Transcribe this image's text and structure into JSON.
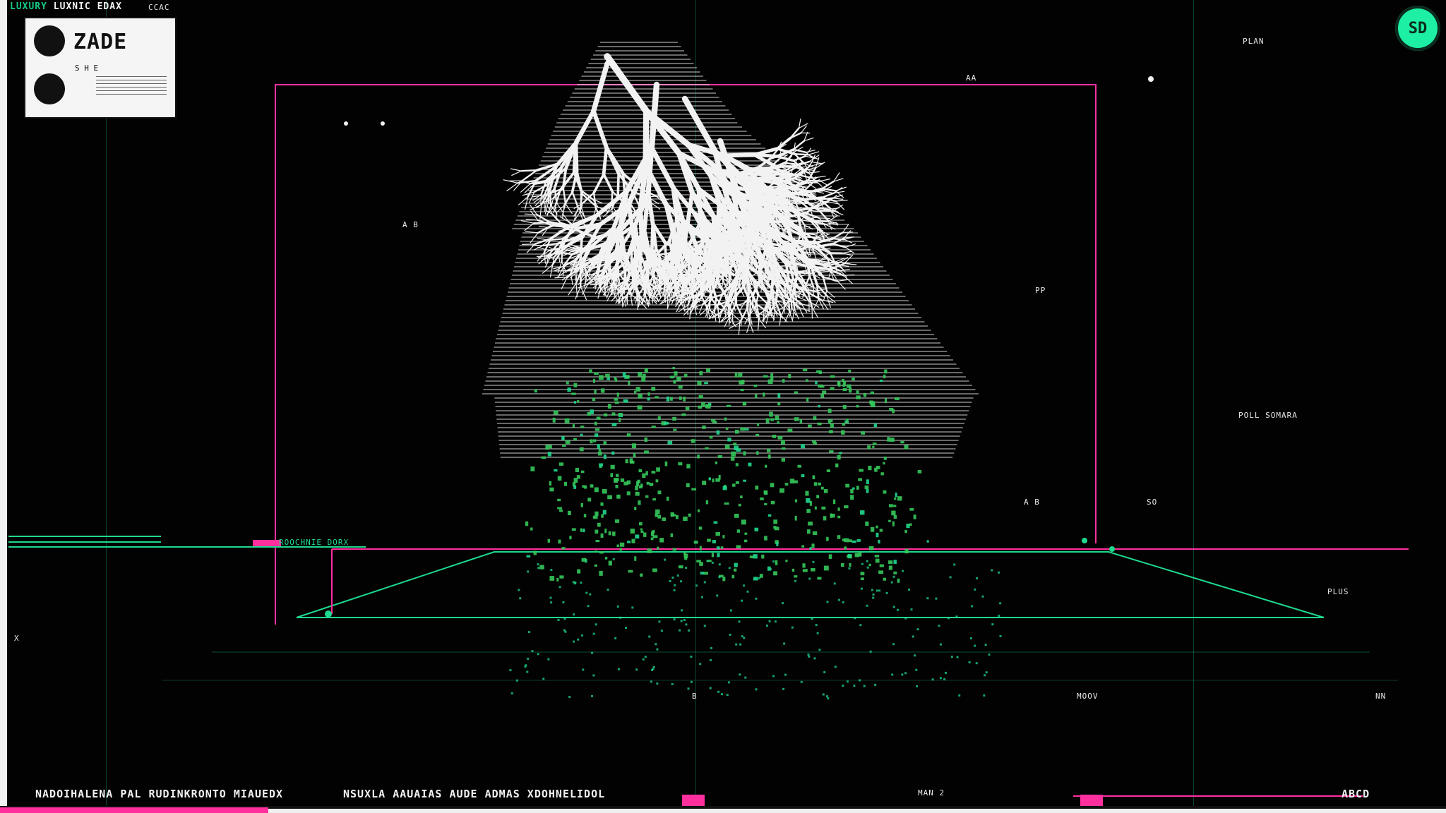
{
  "app": {
    "title_prefix": "LUXURY",
    "title_main": "LUXNIC EDAX",
    "title_right": "CCAC"
  },
  "panel": {
    "title": "ZADE",
    "subtitle": "S H E",
    "icon_top": "avatar-icon",
    "icon_bottom": "map-icon"
  },
  "badge": {
    "label": "SD"
  },
  "labels": {
    "left_grid": "ROOCHNIE DORX",
    "right_grid": "POLL SOMARA",
    "upper_left": "A B",
    "upper_mid": "AA",
    "upper_right": "PLAN",
    "marker_a": "A B",
    "marker_b": "PP",
    "marker_c": "SO",
    "marker_d": "MOOV",
    "marker_e": "B",
    "marker_f": "PLUS",
    "marker_g": "X",
    "marker_h": "NN"
  },
  "footer": {
    "left": "NADOIHALENA PAL RUDINKRONTO MIAUEDX",
    "center": "NSUXLA AAUAIAS AUDE ADMAS XDOHNELIDOL",
    "right": "ABCD",
    "right_note": "MAN 2"
  },
  "colors": {
    "background": "#020202",
    "accent_green": "#1fd98f",
    "accent_pink": "#ff2f9e",
    "line_white": "#f2f2f2",
    "dot_green": "#34c85a"
  }
}
